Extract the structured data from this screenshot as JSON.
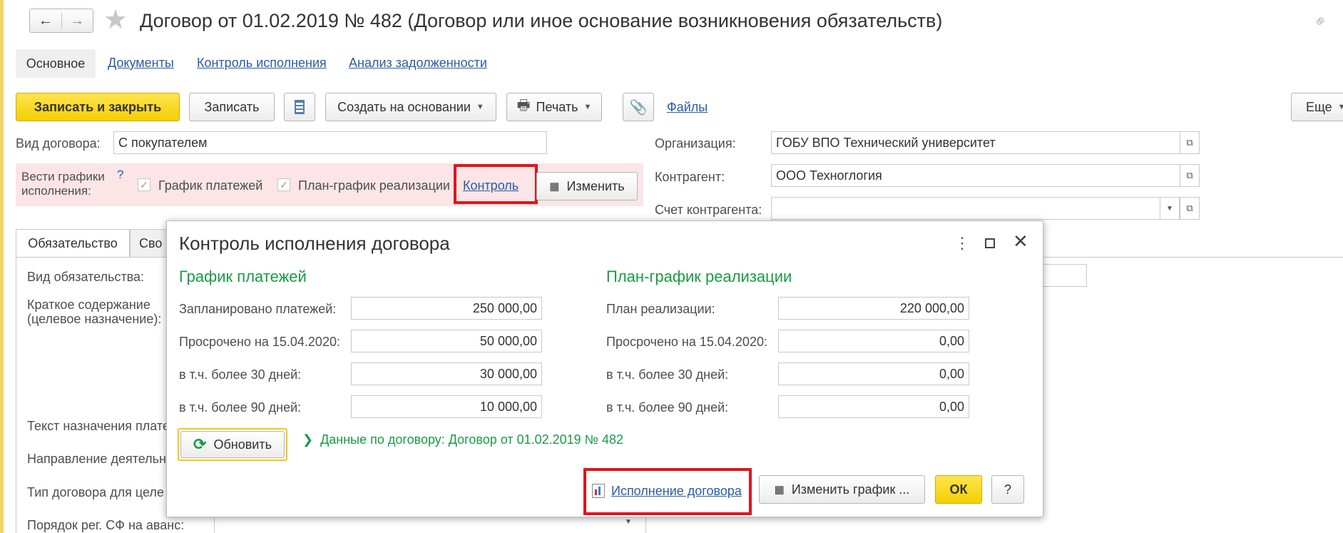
{
  "window": {
    "title": "Договор от 01.02.2019 № 482 (Договор или иное основание возникновения обязательств)"
  },
  "tabs": {
    "main": "Основное",
    "documents": "Документы",
    "control": "Контроль исполнения",
    "debt": "Анализ задолженности"
  },
  "toolbar": {
    "save_close": "Записать и закрыть",
    "save": "Записать",
    "create_based": "Создать на основании",
    "print": "Печать",
    "files": "Файлы",
    "more": "Еще"
  },
  "form": {
    "contract_type_label": "Вид договора:",
    "contract_type_value": "С покупателем",
    "schedules_label_1": "Вести графики",
    "schedules_label_2": "исполнения:",
    "help_mark": "?",
    "payments_check": "График платежей",
    "plan_check": "План-график реализации",
    "control_link": "Контроль",
    "change_button": "Изменить",
    "org_label": "Организация:",
    "org_value": "ГОБУ ВПО Технический университет",
    "counterparty_label": "Контрагент:",
    "counterparty_value": "ООО Техноглогия",
    "account_label": "Счет контрагента:",
    "account_value": ""
  },
  "subtabs": {
    "obligation": "Обязательство",
    "properties_partial": "Сво"
  },
  "left_labels": {
    "obligation_kind": "Вид обязательства:",
    "summary_1": "Краткое содержание",
    "summary_2": "(целевое назначение):",
    "payment_text": "Текст назначения плате",
    "activity": "Направление деятельн",
    "contract_type_for": "Тип договора для целе",
    "invoice_order": "Порядок рег. СФ на аванс:"
  },
  "dialog": {
    "title": "Контроль исполнения договора",
    "payments_title": "График платежей",
    "plan_title": "План-график реализации",
    "planned_label": "Запланировано платежей:",
    "planned_value": "250 000,00",
    "overdue_label": "Просрочено на 15.04.2020:",
    "overdue_value": "50 000,00",
    "over30_label": "в т.ч. более 30 дней:",
    "over30_value": "30 000,00",
    "over90_label": "в т.ч. более 90 дней:",
    "over90_value": "10 000,00",
    "plan_label": "План реализации:",
    "plan_value": "220 000,00",
    "plan_overdue_label": "Просрочено на 15.04.2020:",
    "plan_overdue_value": "0,00",
    "plan_over30_label": "в т.ч. более 30 дней:",
    "plan_over30_value": "0,00",
    "plan_over90_label": "в т.ч. более 90 дней:",
    "plan_over90_value": "0,00",
    "refresh_button": "Обновить",
    "contract_data": "Данные по договору: Договор от 01.02.2019 № 482",
    "execution_link": "Исполнение договора",
    "change_schedule_button": "Изменить график ...",
    "ok_button": "ОК",
    "help_button": "?"
  },
  "colors": {
    "accent_yellow": "#f4cf00",
    "green": "#1a9a45",
    "link": "#2a5ba8",
    "highlight_red": "#e0141e",
    "pink_bg": "#fbe5e6"
  }
}
